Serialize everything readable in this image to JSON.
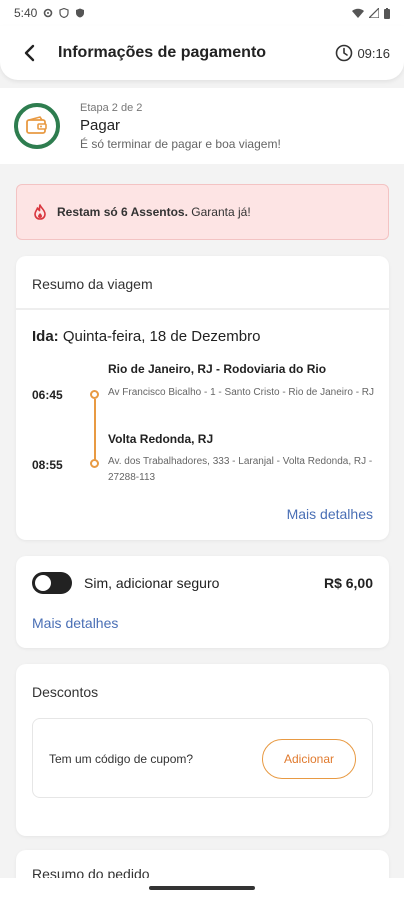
{
  "status": {
    "time": "5:40"
  },
  "header": {
    "title": "Informações de pagamento",
    "timer": "09:16"
  },
  "step": {
    "label": "Etapa 2 de 2",
    "title": "Pagar",
    "subtitle": "É só terminar de pagar e boa viagem!"
  },
  "alert": {
    "strong": "Restam só 6 Assentos.",
    "rest": " Garanta já!"
  },
  "summary": {
    "title": "Resumo da viagem",
    "ida_label": "Ida:",
    "ida_date": " Quinta-feira, 18 de Dezembro",
    "origin": {
      "time": "06:45",
      "name": "Rio de Janeiro, RJ - Rodoviaria do Rio",
      "address": "Av Francisco Bicalho - 1 - Santo Cristo - Rio de Janeiro - RJ"
    },
    "destination": {
      "time": "08:55",
      "name": "Volta Redonda, RJ",
      "address": "Av. dos Trabalhadores, 333 - Laranjal - Volta Redonda, RJ - 27288-113"
    },
    "more_link": "Mais detalhes"
  },
  "insurance": {
    "label": "Sim, adicionar seguro",
    "price": "R$ 6,00",
    "more_link": "Mais detalhes",
    "enabled": false
  },
  "discounts": {
    "title": "Descontos",
    "question": "Tem um código de cupom?",
    "button": "Adicionar"
  },
  "order": {
    "title": "Resumo do pedido"
  },
  "colors": {
    "accent": "#e89a43",
    "brand_green": "#2e7d4f",
    "link": "#4a6fb5",
    "alert_bg": "#fde4e4"
  }
}
